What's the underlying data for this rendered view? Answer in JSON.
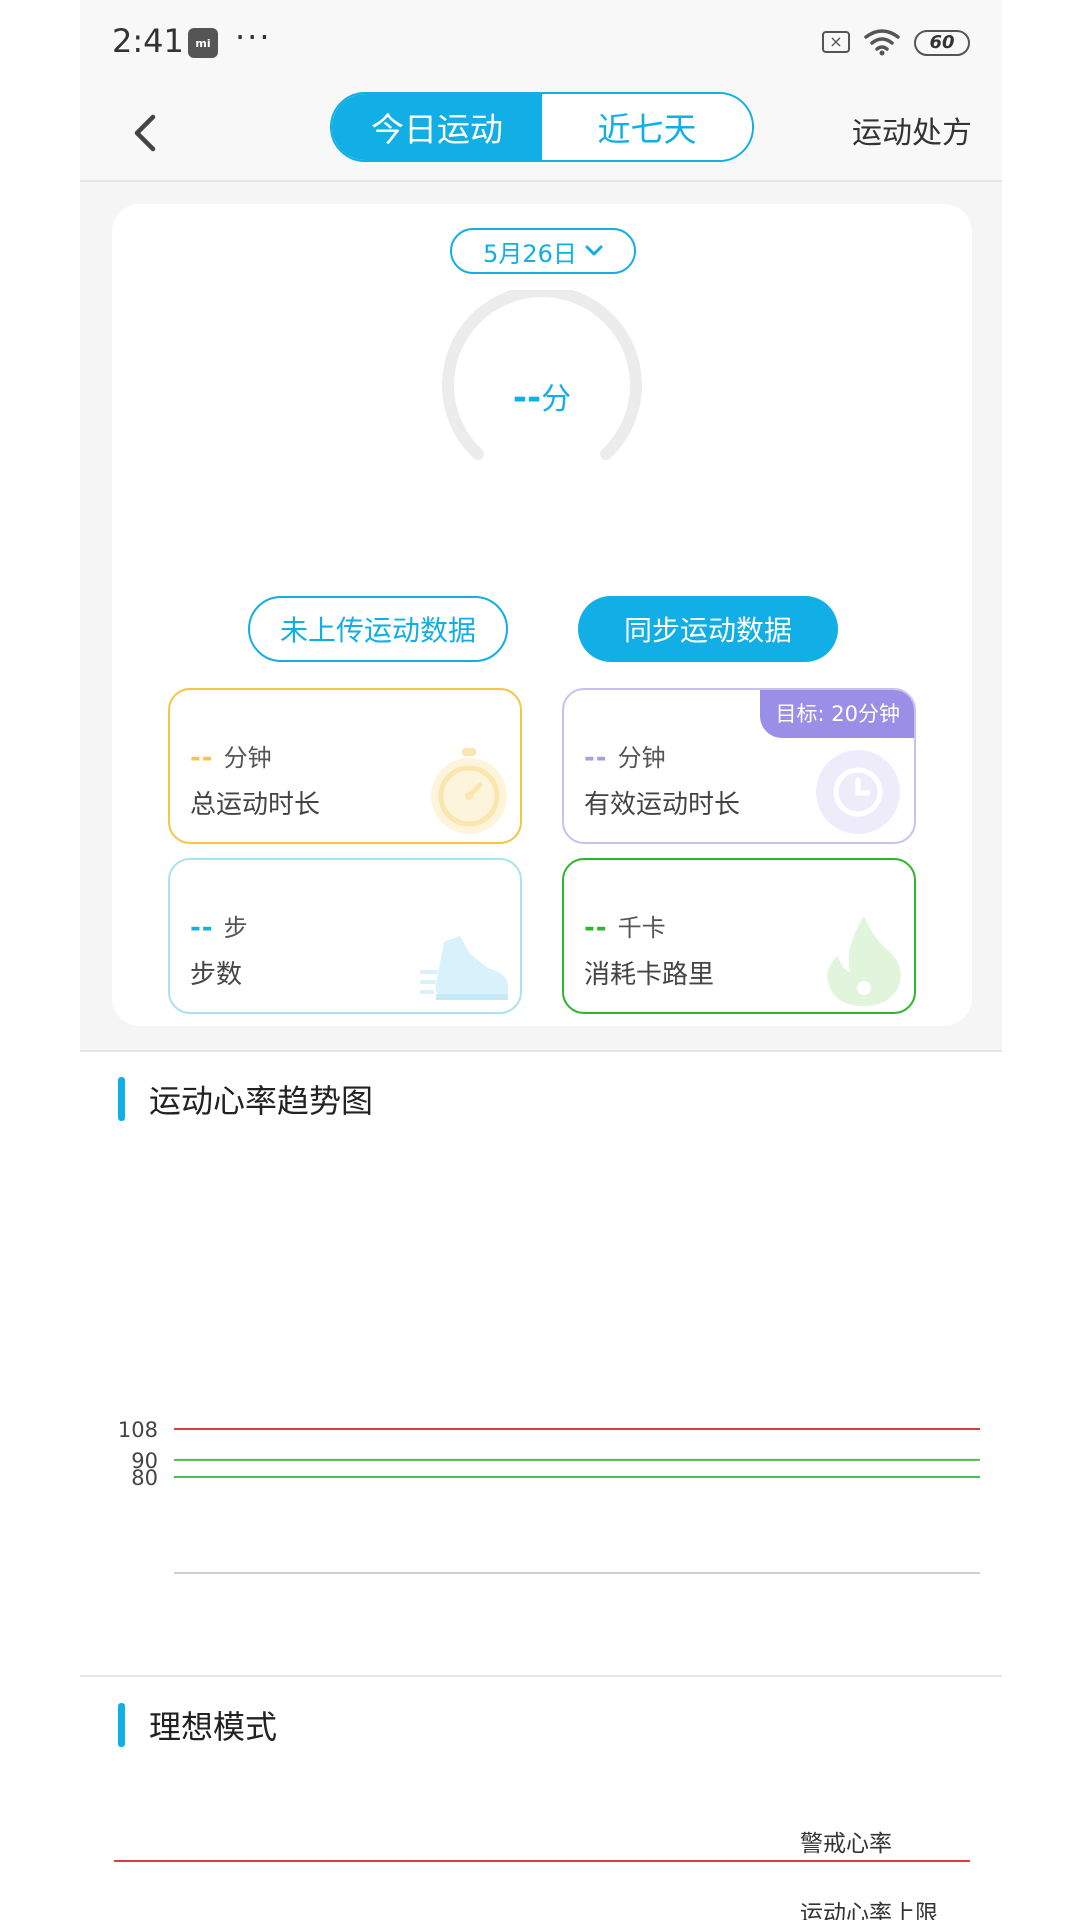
{
  "status": {
    "time": "2:41",
    "dots": "···",
    "battery": "60",
    "mi_label": "mi"
  },
  "nav": {
    "tab_today": "今日运动",
    "tab_week": "近七天",
    "right_link": "运动处方"
  },
  "date": {
    "label": "5月26日"
  },
  "gauge": {
    "value": "--",
    "unit": "分"
  },
  "buttons": {
    "not_uploaded": "未上传运动数据",
    "sync": "同步运动数据"
  },
  "stats": [
    {
      "value": "--",
      "unit": "分钟",
      "label": "总运动时长",
      "accent": "#f6c544"
    },
    {
      "value": "--",
      "unit": "分钟",
      "label": "有效运动时长",
      "accent": "#a89ee8",
      "goal": "目标: 20分钟"
    },
    {
      "value": "--",
      "unit": "步",
      "label": "步数",
      "accent": "#12aee6"
    },
    {
      "value": "--",
      "unit": "千卡",
      "label": "消耗卡路里",
      "accent": "#2db52d"
    }
  ],
  "heart_section": {
    "title": "运动心率趋势图"
  },
  "chart_data": {
    "type": "line",
    "title": "",
    "series": [],
    "reference_lines": [
      {
        "value": 108,
        "color": "#e03a3a"
      },
      {
        "value": 90,
        "color": "#4cc04c"
      },
      {
        "value": 80,
        "color": "#4cc04c"
      }
    ],
    "ytick_labels": [
      "108",
      "90",
      "80"
    ]
  },
  "ideal_section": {
    "title": "理想模式",
    "lines": [
      {
        "label": "警戒心率",
        "color": "#e03a3a"
      },
      {
        "label": "运动心率上限",
        "color": "#4cc04c"
      }
    ]
  }
}
